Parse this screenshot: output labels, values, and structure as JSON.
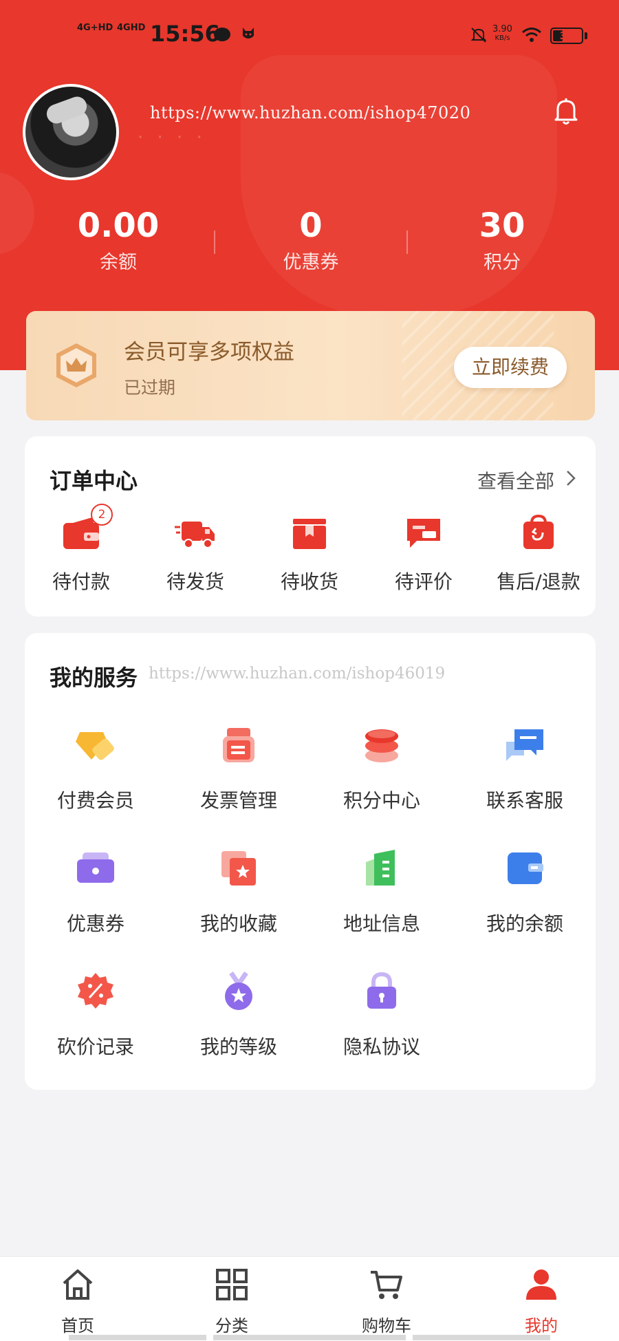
{
  "status_bar": {
    "network1": "4G+HD",
    "network2": "4GHD",
    "time": "15:56",
    "speed_value": "3.90",
    "speed_unit": "KB/s",
    "battery": "35",
    "battery_level": 0.35
  },
  "profile": {
    "watermark_url": "https://www.huzhan.com/ishop47020"
  },
  "stats": [
    {
      "value": "0.00",
      "label": "余额"
    },
    {
      "value": "0",
      "label": "优惠券"
    },
    {
      "value": "30",
      "label": "积分"
    }
  ],
  "vip": {
    "title": "会员可享多项权益",
    "status": "已过期",
    "button": "立即续费"
  },
  "orders": {
    "title": "订单中心",
    "view_all": "查看全部",
    "items": [
      {
        "label": "待付款",
        "icon": "wallet-icon",
        "badge": "2"
      },
      {
        "label": "待发货",
        "icon": "delivery-truck-icon"
      },
      {
        "label": "待收货",
        "icon": "package-box-icon"
      },
      {
        "label": "待评价",
        "icon": "comment-card-icon"
      },
      {
        "label": "售后/退款",
        "icon": "refund-bag-icon"
      }
    ]
  },
  "services": {
    "title": "我的服务",
    "watermark_url": "https://www.huzhan.com/ishop46019",
    "items": [
      {
        "label": "付费会员",
        "icon": "gem-icon"
      },
      {
        "label": "发票管理",
        "icon": "invoice-icon"
      },
      {
        "label": "积分中心",
        "icon": "coin-stack-icon"
      },
      {
        "label": "联系客服",
        "icon": "chat-bubble-icon"
      },
      {
        "label": "优惠券",
        "icon": "coupon-icon"
      },
      {
        "label": "我的收藏",
        "icon": "favorite-star-icon"
      },
      {
        "label": "地址信息",
        "icon": "address-book-icon"
      },
      {
        "label": "我的余额",
        "icon": "balance-wallet-icon"
      },
      {
        "label": "砍价记录",
        "icon": "discount-badge-icon"
      },
      {
        "label": "我的等级",
        "icon": "medal-icon"
      },
      {
        "label": "隐私协议",
        "icon": "lock-icon"
      }
    ]
  },
  "tabbar": [
    {
      "label": "首页",
      "icon": "home-icon"
    },
    {
      "label": "分类",
      "icon": "category-grid-icon"
    },
    {
      "label": "购物车",
      "icon": "cart-icon"
    },
    {
      "label": "我的",
      "icon": "user-icon",
      "active": true
    }
  ],
  "colors": {
    "primary": "#e8372c",
    "vip_text": "#8a5a2b",
    "background": "#f3f3f5"
  }
}
